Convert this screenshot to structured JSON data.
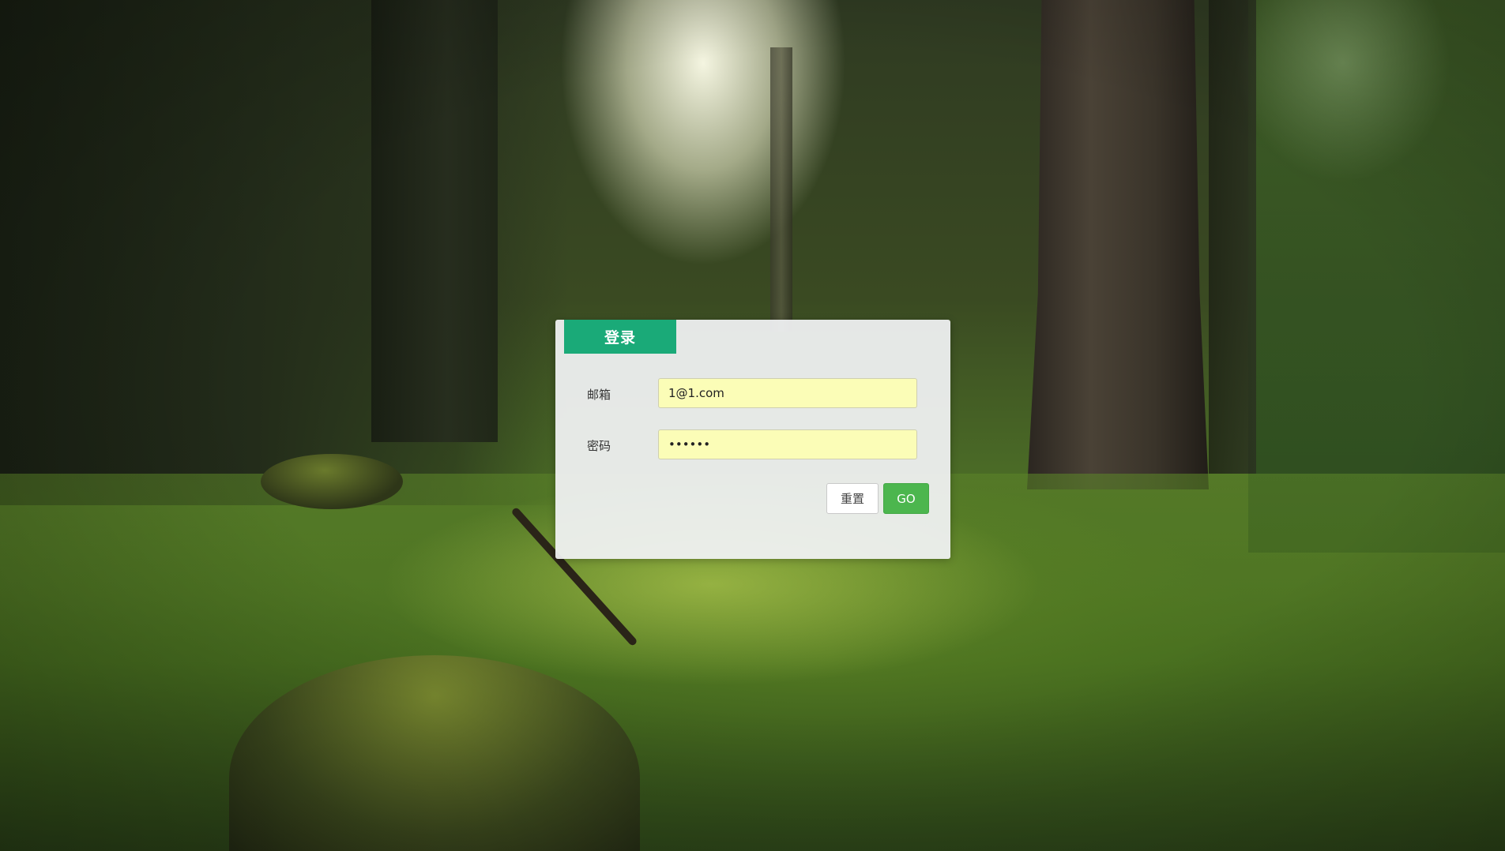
{
  "login": {
    "tab_label": "登录",
    "email_label": "邮箱",
    "email_value": "1@1.com",
    "password_label": "密码",
    "password_value": "123456",
    "reset_label": "重置",
    "go_label": "GO"
  },
  "colors": {
    "tab_accent": "#1aaa78",
    "go_button": "#4cb64e",
    "input_autofill": "#fbfdb7"
  }
}
